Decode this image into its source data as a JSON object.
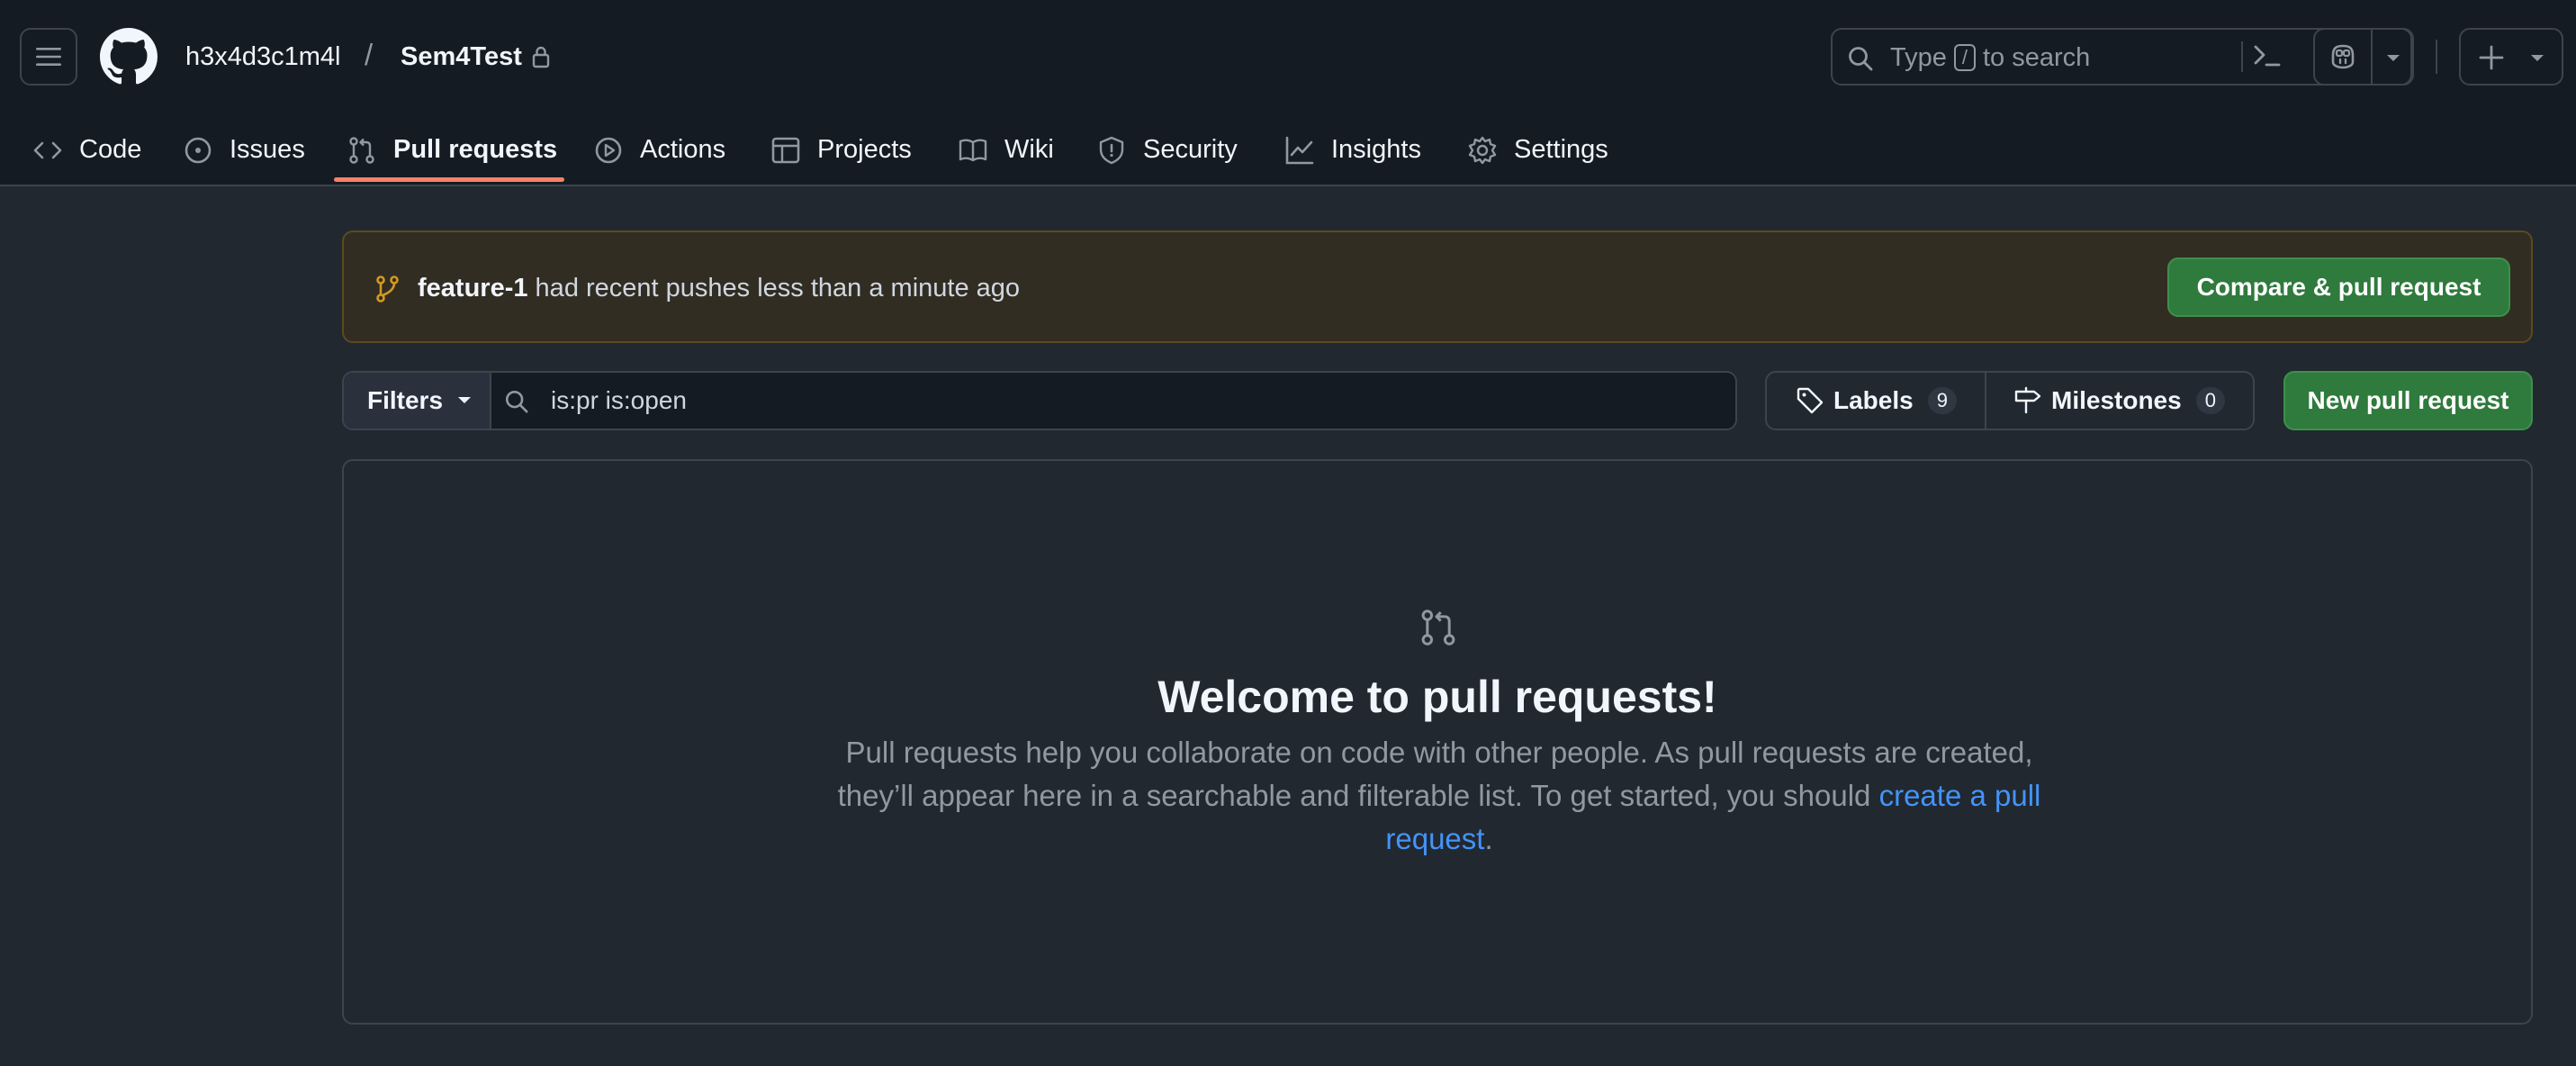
{
  "header": {
    "owner": "h3x4d3c1m4l",
    "separator": "/",
    "repo": "Sem4Test",
    "search": {
      "prefix": "Type",
      "key": "/",
      "suffix": "to search"
    }
  },
  "tabs": [
    {
      "label": "Code",
      "icon": "code-icon"
    },
    {
      "label": "Issues",
      "icon": "issue-opened-icon"
    },
    {
      "label": "Pull requests",
      "icon": "git-pull-request-icon",
      "selected": true
    },
    {
      "label": "Actions",
      "icon": "play-icon"
    },
    {
      "label": "Projects",
      "icon": "table-icon"
    },
    {
      "label": "Wiki",
      "icon": "book-icon"
    },
    {
      "label": "Security",
      "icon": "shield-icon"
    },
    {
      "label": "Insights",
      "icon": "graph-icon"
    },
    {
      "label": "Settings",
      "icon": "gear-icon"
    }
  ],
  "banner": {
    "branch": "feature-1",
    "message": " had recent pushes less than a minute ago",
    "compare_button": "Compare & pull request"
  },
  "filterbar": {
    "filters_label": "Filters",
    "search_value": "is:pr is:open",
    "labels_label": "Labels",
    "labels_count": "9",
    "milestones_label": "Milestones",
    "milestones_count": "0",
    "new_pr_button": "New pull request"
  },
  "blankslate": {
    "title": "Welcome to pull requests!",
    "description": "Pull requests help you collaborate on code with other people. As pull requests are created, they’ll appear here in a searchable and filterable list. To get started, you should ",
    "link_text": "create a pull request",
    "trailing": "."
  },
  "colors": {
    "accent_tab_underline": "#f78166",
    "primary_button": "#2f7a3d",
    "link": "#4493f8",
    "banner_bg": "#322d23",
    "branch_icon": "#d29922"
  }
}
